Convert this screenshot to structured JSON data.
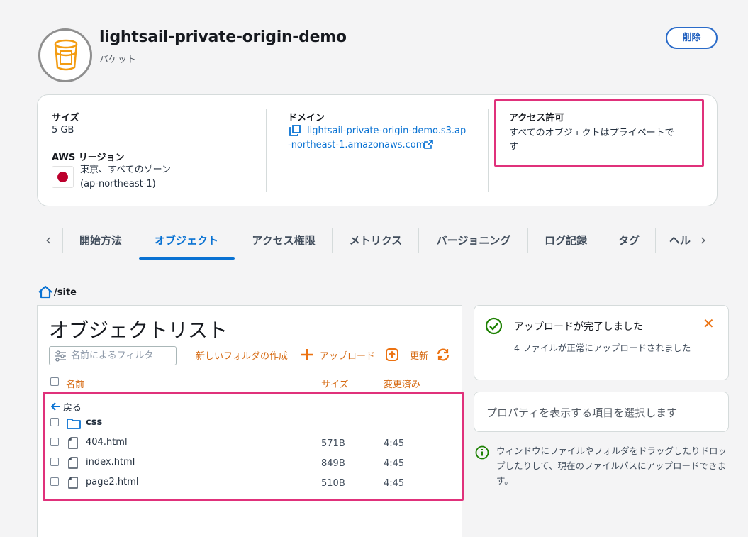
{
  "header": {
    "title": "lightsail-private-origin-demo",
    "subtitle": "バケット",
    "delete_label": "削除",
    "avatar_icon": "bucket-icon"
  },
  "info": {
    "size_label": "サイズ",
    "size_value": "5 GB",
    "region_label": "AWS リージョン",
    "region_value_line1": "東京、すべてのゾーン",
    "region_value_line2": "(ap-northeast-1)",
    "domain_label": "ドメイン",
    "domain_line1": "lightsail-private-origin-demo.s3.ap",
    "domain_line2": "-northeast-1.amazonaws.com",
    "access_label": "アクセス許可",
    "access_line1": "すべてのオブジェクトはプライベートで",
    "access_line2": "す"
  },
  "tabs": [
    {
      "label": "開始方法"
    },
    {
      "label": "オブジェクト"
    },
    {
      "label": "アクセス権限"
    },
    {
      "label": "メトリクス"
    },
    {
      "label": "バージョニング"
    },
    {
      "label": "ログ記録"
    },
    {
      "label": "タグ"
    },
    {
      "label": "ヘル"
    }
  ],
  "breadcrumb": {
    "path": "/site"
  },
  "objects": {
    "title": "オブジェクトリスト",
    "filter_placeholder": "名前によるフィルタ",
    "new_folder_label": "新しいフォルダの作成",
    "upload_label": "アップロード",
    "refresh_label": "更新",
    "col_name": "名前",
    "col_size": "サイズ",
    "col_modified": "変更済み",
    "back_label": "戻る",
    "folder": {
      "name": "css"
    },
    "rows": [
      {
        "name": "404.html",
        "size": "571B",
        "modified": "4:45"
      },
      {
        "name": "index.html",
        "size": "849B",
        "modified": "4:45"
      },
      {
        "name": "page2.html",
        "size": "510B",
        "modified": "4:45"
      }
    ]
  },
  "notice": {
    "title": "アップロードが完了しました",
    "body": "4 ファイルが正常にアップロードされました"
  },
  "properties": {
    "placeholder": "プロパティを表示する項目を選択します"
  },
  "hint": {
    "text": "ウィンドウにファイルやフォルダをドラッグしたりドロップしたりして、現在のファイルパスにアップロードできます。"
  },
  "colors": {
    "accent": "#0972d3",
    "action": "#ec7211",
    "highlight": "#e0317b",
    "success": "#1d8102"
  }
}
